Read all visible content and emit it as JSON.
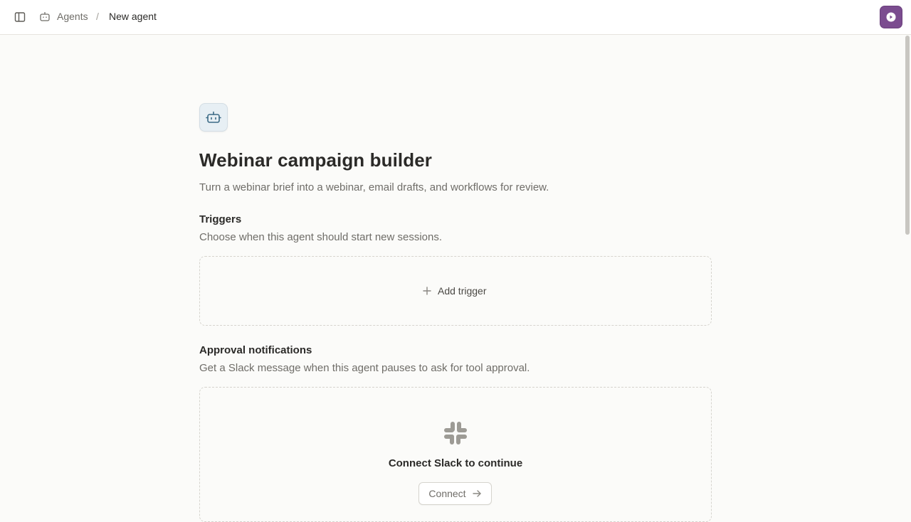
{
  "breadcrumb": {
    "parent_label": "Agents",
    "separator": "/",
    "current_label": "New agent"
  },
  "agent": {
    "icon": "robot-icon",
    "title": "Webinar campaign builder",
    "description": "Turn a webinar brief into a webinar, email drafts, and workflows for review."
  },
  "triggers": {
    "title": "Triggers",
    "description": "Choose when this agent should start new sessions.",
    "add_label": "Add trigger"
  },
  "approval": {
    "title": "Approval notifications",
    "description": "Get a Slack message when this agent pauses to ask for tool approval.",
    "connect_title": "Connect Slack to continue",
    "connect_label": "Connect"
  },
  "colors": {
    "avatar_bg": "#7b4c8f",
    "agent_icon_bg": "#e7eff4",
    "page_bg": "#fbfbf9"
  }
}
